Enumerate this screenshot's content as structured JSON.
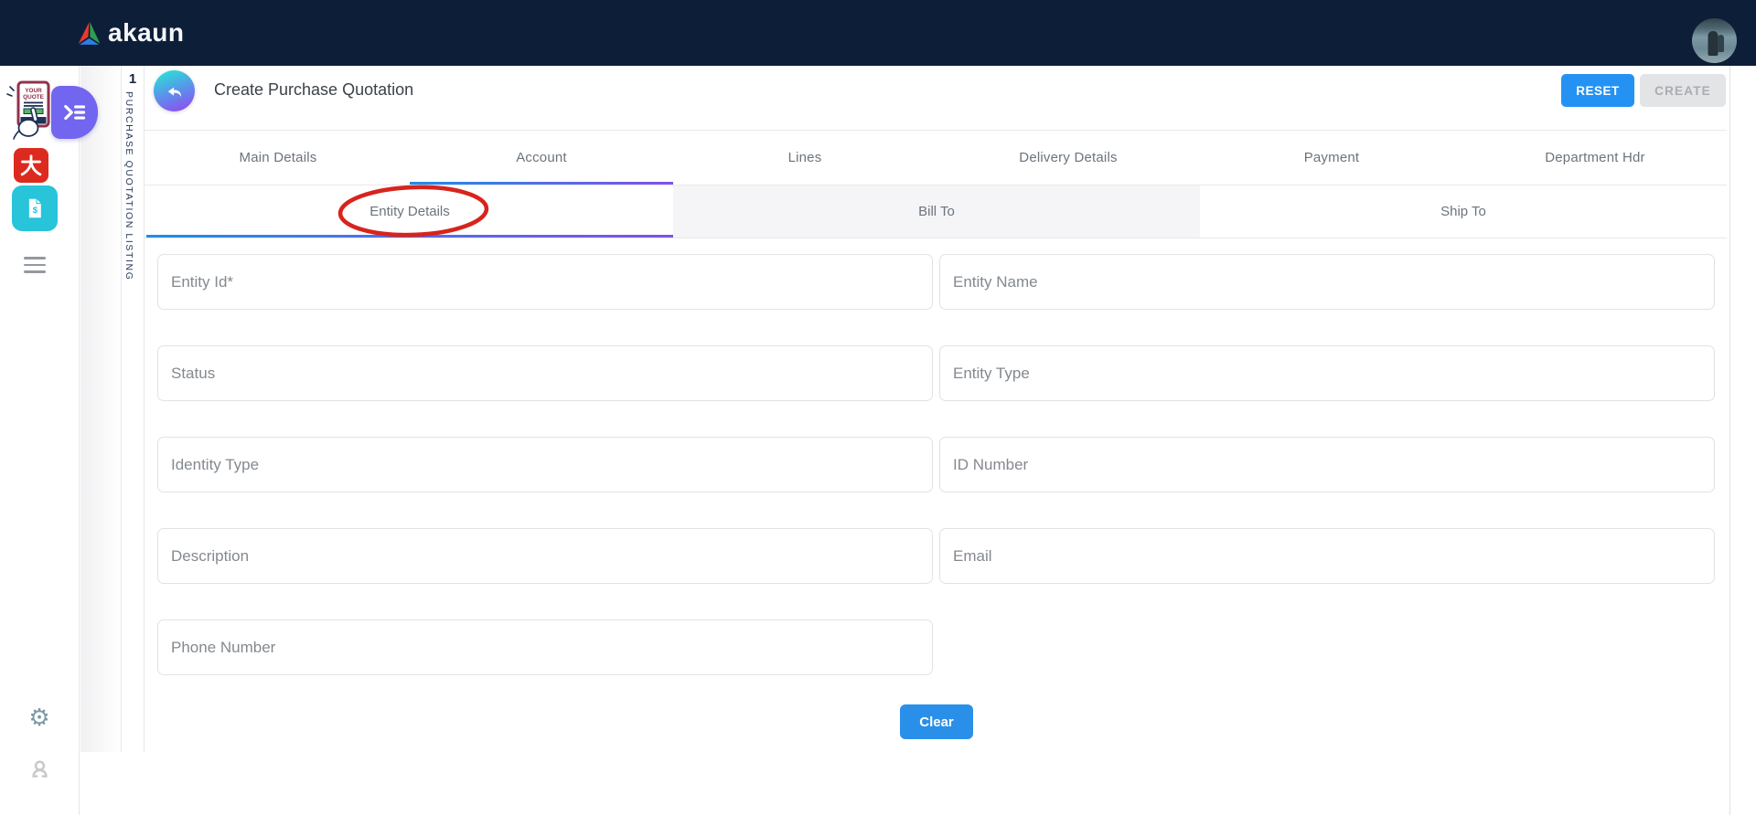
{
  "brand": {
    "name": "akaun"
  },
  "sidebar": {
    "listing_count": "1",
    "listing_label": "PURCHASE QUOTATION LISTING",
    "quote_app": {
      "line1": "YOUR",
      "line2": "QUOTE"
    },
    "red_app_glyph": "大"
  },
  "icons": {
    "gear": "⚙",
    "doc_dollar": "$"
  },
  "header": {
    "title": "Create Purchase Quotation",
    "reset": "RESET",
    "create": "CREATE"
  },
  "tabs": [
    {
      "label": "Main Details",
      "active": false
    },
    {
      "label": "Account",
      "active": true
    },
    {
      "label": "Lines",
      "active": false
    },
    {
      "label": "Delivery Details",
      "active": false
    },
    {
      "label": "Payment",
      "active": false
    },
    {
      "label": "Department Hdr",
      "active": false
    }
  ],
  "subtabs": [
    {
      "label": "Entity Details",
      "active": true,
      "annotated": true
    },
    {
      "label": "Bill To",
      "active": false
    },
    {
      "label": "Ship To",
      "active": false
    }
  ],
  "form": {
    "fields": [
      {
        "placeholder": "Entity Id*",
        "value": ""
      },
      {
        "placeholder": "Entity Name",
        "value": ""
      },
      {
        "placeholder": "Status",
        "value": ""
      },
      {
        "placeholder": "Entity Type",
        "value": ""
      },
      {
        "placeholder": "Identity Type",
        "value": ""
      },
      {
        "placeholder": "ID Number",
        "value": ""
      },
      {
        "placeholder": "Description",
        "value": ""
      },
      {
        "placeholder": "Email",
        "value": ""
      },
      {
        "placeholder": "Phone Number",
        "value": ""
      }
    ],
    "clear": "Clear"
  },
  "annotation": {
    "shape": "ellipse",
    "color": "#d8241c",
    "target": "Entity Details"
  },
  "colors": {
    "topbar_navy": "#0d1e38",
    "primary_blue": "#2492f3",
    "underline_gradient_start": "#1d8fe8",
    "underline_gradient_end": "#8250ec",
    "annotation_red": "#d8241c"
  }
}
